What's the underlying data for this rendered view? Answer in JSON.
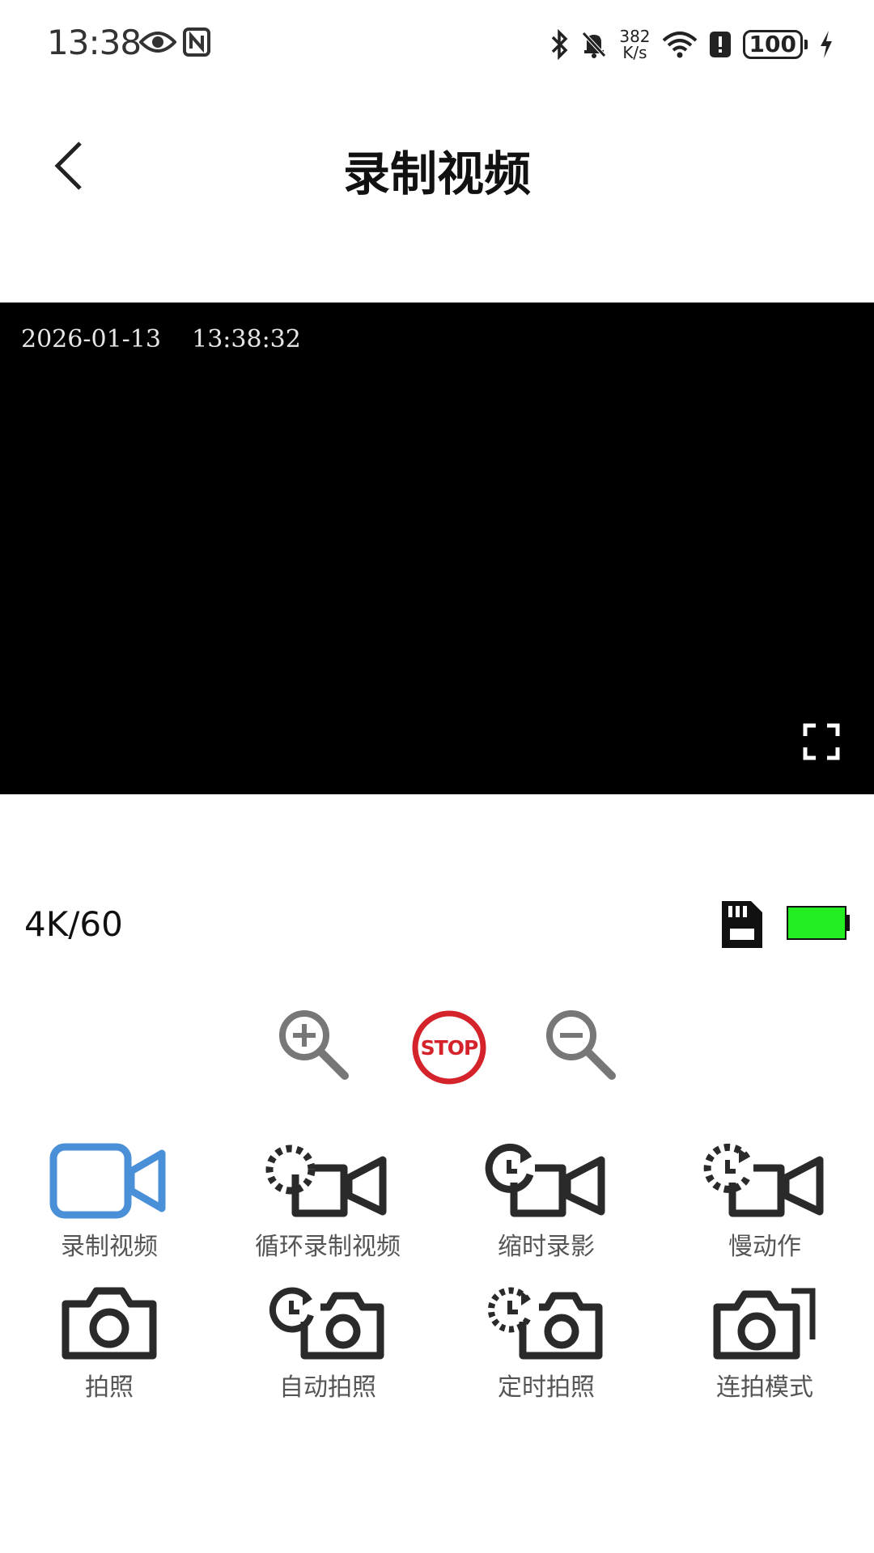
{
  "status_bar": {
    "time": "13:38",
    "net_speed_value": "382",
    "net_speed_unit": "K/s",
    "battery": "100",
    "icons": [
      "eye-icon",
      "nfc-icon",
      "bluetooth-icon",
      "bell-off-icon",
      "wifi-icon",
      "alert-icon",
      "battery-icon",
      "charging-icon"
    ]
  },
  "header": {
    "title": "录制视频",
    "back_icon": "chevron-left-icon"
  },
  "preview": {
    "timestamp": "2026-01-13    13:38:32",
    "fullscreen_icon": "fullscreen-icon"
  },
  "info": {
    "resolution": "4K/60",
    "sd_icon": "sd-card-icon",
    "battery_color": "#22ee22"
  },
  "controls": {
    "zoom_in_icon": "zoom-in-icon",
    "stop_label": "STOP",
    "stop_color": "#d4232b",
    "zoom_out_icon": "zoom-out-icon"
  },
  "modes": [
    {
      "label": "录制视频",
      "icon": "video-camera-icon",
      "active": true
    },
    {
      "label": "循环录制视频",
      "icon": "loop-video-icon",
      "active": false
    },
    {
      "label": "缩时录影",
      "icon": "timelapse-video-icon",
      "active": false
    },
    {
      "label": "慢动作",
      "icon": "slow-motion-icon",
      "active": false
    },
    {
      "label": "拍照",
      "icon": "camera-icon",
      "active": false
    },
    {
      "label": "自动拍照",
      "icon": "auto-photo-icon",
      "active": false
    },
    {
      "label": "定时拍照",
      "icon": "timer-photo-icon",
      "active": false
    },
    {
      "label": "连拍模式",
      "icon": "burst-photo-icon",
      "active": false
    }
  ],
  "colors": {
    "active_accent": "#4a90d9",
    "icon_dark": "#2a2a2a",
    "zoom_gray": "#777777"
  }
}
